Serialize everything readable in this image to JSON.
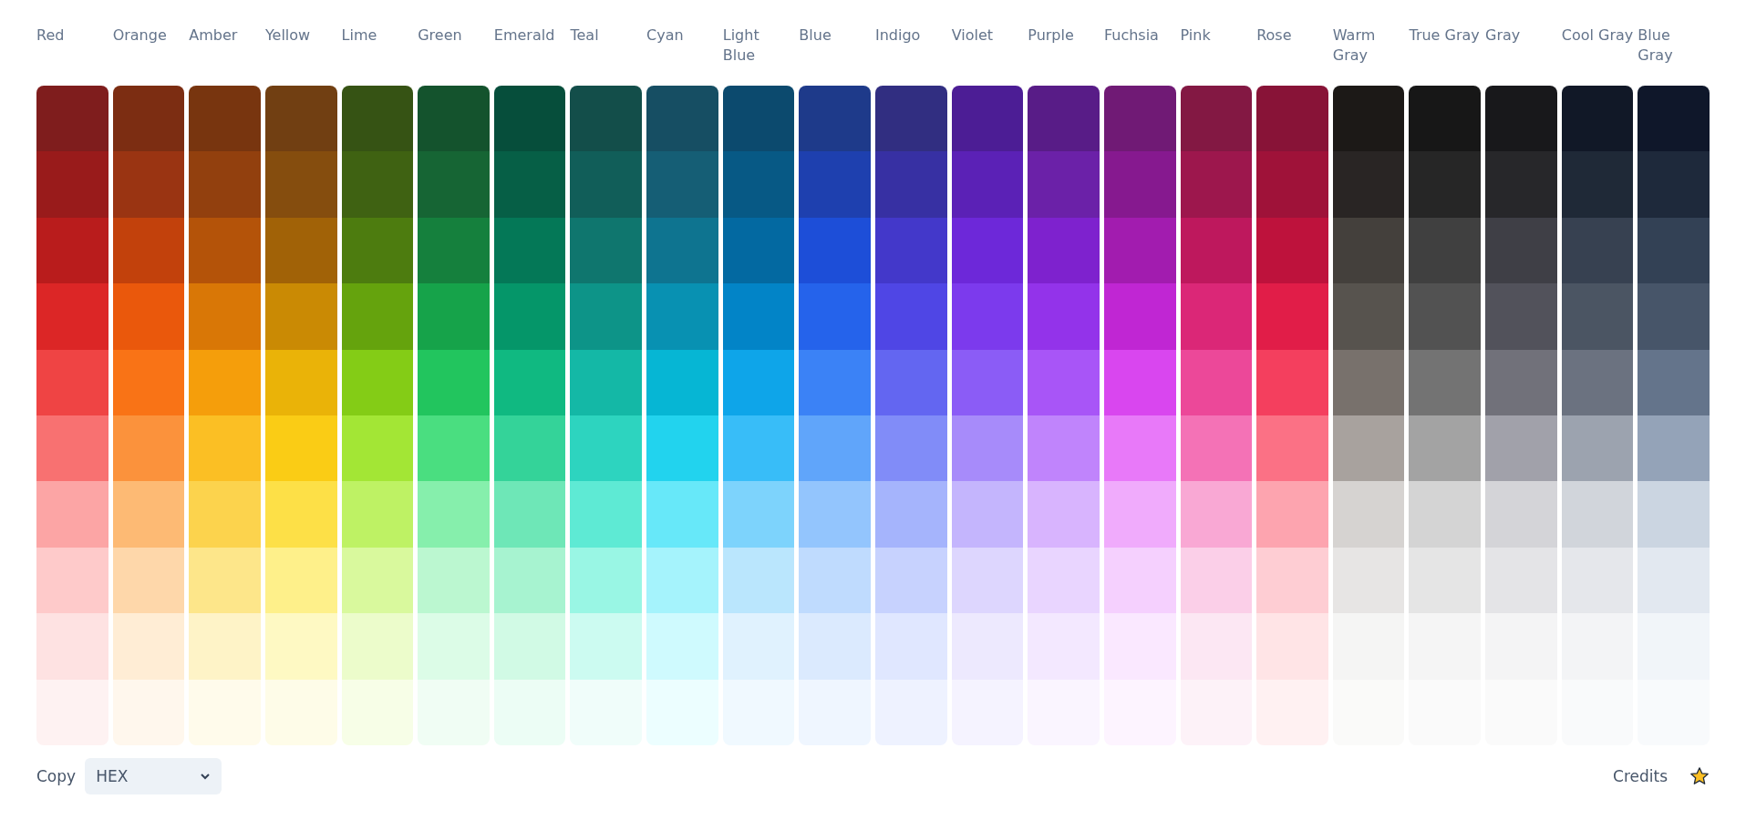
{
  "palettes": [
    {
      "name": "Red",
      "shades": [
        {
          "color": "#7f1d1d"
        },
        {
          "color": "#991b1b"
        },
        {
          "color": "#b91c1c"
        },
        {
          "color": "#dc2626"
        },
        {
          "color": "#ef4444"
        },
        {
          "color": "#f87171"
        },
        {
          "color": "#fca5a5"
        },
        {
          "color": "#fecaca"
        },
        {
          "color": "#fee2e2"
        },
        {
          "color": "#fef2f2"
        }
      ]
    },
    {
      "name": "Orange",
      "shades": [
        {
          "color": "#7c2d12"
        },
        {
          "color": "#9a3412"
        },
        {
          "color": "#c2410c"
        },
        {
          "color": "#ea580c"
        },
        {
          "color": "#f97316"
        },
        {
          "color": "#fb923c"
        },
        {
          "color": "#fdba74"
        },
        {
          "color": "#fed7aa"
        },
        {
          "color": "#ffedd5"
        },
        {
          "color": "#fff7ed"
        }
      ]
    },
    {
      "name": "Amber",
      "shades": [
        {
          "color": "#78350f"
        },
        {
          "color": "#92400e"
        },
        {
          "color": "#b45309"
        },
        {
          "color": "#d97706"
        },
        {
          "color": "#f59e0b"
        },
        {
          "color": "#fbbf24"
        },
        {
          "color": "#fcd34d"
        },
        {
          "color": "#fde68a"
        },
        {
          "color": "#fef3c7"
        },
        {
          "color": "#fffbeb"
        }
      ]
    },
    {
      "name": "Yellow",
      "shades": [
        {
          "color": "#713f12"
        },
        {
          "color": "#854d0e"
        },
        {
          "color": "#a16207"
        },
        {
          "color": "#ca8a04"
        },
        {
          "color": "#eab308"
        },
        {
          "color": "#facc15"
        },
        {
          "color": "#fde047"
        },
        {
          "color": "#fef08a"
        },
        {
          "color": "#fef9c3"
        },
        {
          "color": "#fefce8"
        }
      ]
    },
    {
      "name": "Lime",
      "shades": [
        {
          "color": "#365314"
        },
        {
          "color": "#3f6212"
        },
        {
          "color": "#4d7c0f"
        },
        {
          "color": "#65a30d"
        },
        {
          "color": "#84cc16"
        },
        {
          "color": "#a3e635"
        },
        {
          "color": "#bef264"
        },
        {
          "color": "#d9f99d"
        },
        {
          "color": "#ecfccb"
        },
        {
          "color": "#f7fee7"
        }
      ]
    },
    {
      "name": "Green",
      "shades": [
        {
          "color": "#14532d"
        },
        {
          "color": "#166534"
        },
        {
          "color": "#15803d"
        },
        {
          "color": "#16a34a"
        },
        {
          "color": "#22c55e"
        },
        {
          "color": "#4ade80"
        },
        {
          "color": "#86efac"
        },
        {
          "color": "#bbf7d0"
        },
        {
          "color": "#dcfce7"
        },
        {
          "color": "#f0fdf4"
        }
      ]
    },
    {
      "name": "Emerald",
      "shades": [
        {
          "color": "#064e3b"
        },
        {
          "color": "#065f46"
        },
        {
          "color": "#047857"
        },
        {
          "color": "#059669"
        },
        {
          "color": "#10b981"
        },
        {
          "color": "#34d399"
        },
        {
          "color": "#6ee7b7"
        },
        {
          "color": "#a7f3d0"
        },
        {
          "color": "#d1fae5"
        },
        {
          "color": "#ecfdf5"
        }
      ]
    },
    {
      "name": "Teal",
      "shades": [
        {
          "color": "#134e4a"
        },
        {
          "color": "#115e59"
        },
        {
          "color": "#0f766e"
        },
        {
          "color": "#0d9488"
        },
        {
          "color": "#14b8a6"
        },
        {
          "color": "#2dd4bf"
        },
        {
          "color": "#5eead4"
        },
        {
          "color": "#99f6e4"
        },
        {
          "color": "#ccfbf1"
        },
        {
          "color": "#f0fdfa"
        }
      ]
    },
    {
      "name": "Cyan",
      "shades": [
        {
          "color": "#164e63"
        },
        {
          "color": "#155e75"
        },
        {
          "color": "#0e7490"
        },
        {
          "color": "#0891b2"
        },
        {
          "color": "#06b6d4"
        },
        {
          "color": "#22d3ee"
        },
        {
          "color": "#67e8f9"
        },
        {
          "color": "#a5f3fc"
        },
        {
          "color": "#cffafe"
        },
        {
          "color": "#ecfeff"
        }
      ]
    },
    {
      "name": "Light Blue",
      "shades": [
        {
          "color": "#0c4a6e"
        },
        {
          "color": "#075985"
        },
        {
          "color": "#0369a1"
        },
        {
          "color": "#0284c7"
        },
        {
          "color": "#0ea5e9"
        },
        {
          "color": "#38bdf8"
        },
        {
          "color": "#7dd3fc"
        },
        {
          "color": "#bae6fd"
        },
        {
          "color": "#e0f2fe"
        },
        {
          "color": "#f0f9ff"
        }
      ]
    },
    {
      "name": "Blue",
      "shades": [
        {
          "color": "#1e3a8a"
        },
        {
          "color": "#1e40af"
        },
        {
          "color": "#1d4ed8"
        },
        {
          "color": "#2563eb"
        },
        {
          "color": "#3b82f6"
        },
        {
          "color": "#60a5fa"
        },
        {
          "color": "#93c5fd"
        },
        {
          "color": "#bfdbfe"
        },
        {
          "color": "#dbeafe"
        },
        {
          "color": "#eff6ff"
        }
      ]
    },
    {
      "name": "Indigo",
      "shades": [
        {
          "color": "#312e81"
        },
        {
          "color": "#3730a3"
        },
        {
          "color": "#4338ca"
        },
        {
          "color": "#4f46e5"
        },
        {
          "color": "#6366f1"
        },
        {
          "color": "#818cf8"
        },
        {
          "color": "#a5b4fc"
        },
        {
          "color": "#c7d2fe"
        },
        {
          "color": "#e0e7ff"
        },
        {
          "color": "#eef2ff"
        }
      ]
    },
    {
      "name": "Violet",
      "shades": [
        {
          "color": "#4c1d95"
        },
        {
          "color": "#5b21b6"
        },
        {
          "color": "#6d28d9"
        },
        {
          "color": "#7c3aed"
        },
        {
          "color": "#8b5cf6"
        },
        {
          "color": "#a78bfa"
        },
        {
          "color": "#c4b5fd"
        },
        {
          "color": "#ddd6fe"
        },
        {
          "color": "#ede9fe"
        },
        {
          "color": "#f5f3ff"
        }
      ]
    },
    {
      "name": "Purple",
      "shades": [
        {
          "color": "#581c87"
        },
        {
          "color": "#6b21a8"
        },
        {
          "color": "#7e22ce"
        },
        {
          "color": "#9333ea"
        },
        {
          "color": "#a855f7"
        },
        {
          "color": "#c084fc"
        },
        {
          "color": "#d8b4fe"
        },
        {
          "color": "#e9d5ff"
        },
        {
          "color": "#f3e8ff"
        },
        {
          "color": "#faf5ff"
        }
      ]
    },
    {
      "name": "Fuchsia",
      "shades": [
        {
          "color": "#701a75"
        },
        {
          "color": "#86198f"
        },
        {
          "color": "#a21caf"
        },
        {
          "color": "#c026d3"
        },
        {
          "color": "#d946ef"
        },
        {
          "color": "#e879f9"
        },
        {
          "color": "#f0abfc"
        },
        {
          "color": "#f5d0fe"
        },
        {
          "color": "#fae8ff"
        },
        {
          "color": "#fdf4ff"
        }
      ]
    },
    {
      "name": "Pink",
      "shades": [
        {
          "color": "#831843"
        },
        {
          "color": "#9d174d"
        },
        {
          "color": "#be185d"
        },
        {
          "color": "#db2777"
        },
        {
          "color": "#ec4899"
        },
        {
          "color": "#f472b6"
        },
        {
          "color": "#f9a8d4"
        },
        {
          "color": "#fbcfe8"
        },
        {
          "color": "#fce7f3"
        },
        {
          "color": "#fdf2f8"
        }
      ]
    },
    {
      "name": "Rose",
      "shades": [
        {
          "color": "#881337"
        },
        {
          "color": "#9f1239"
        },
        {
          "color": "#be123c"
        },
        {
          "color": "#e11d48"
        },
        {
          "color": "#f43f5e"
        },
        {
          "color": "#fb7185"
        },
        {
          "color": "#fda4af"
        },
        {
          "color": "#fecdd3"
        },
        {
          "color": "#ffe4e6"
        },
        {
          "color": "#fff1f2"
        }
      ]
    },
    {
      "name": "Warm Gray",
      "shades": [
        {
          "color": "#1c1917"
        },
        {
          "color": "#292524"
        },
        {
          "color": "#44403c"
        },
        {
          "color": "#57534e"
        },
        {
          "color": "#78716c"
        },
        {
          "color": "#a8a29e"
        },
        {
          "color": "#d6d3d1"
        },
        {
          "color": "#e7e5e4"
        },
        {
          "color": "#f5f5f4"
        },
        {
          "color": "#fafaf9"
        }
      ]
    },
    {
      "name": "True Gray",
      "shades": [
        {
          "color": "#171717"
        },
        {
          "color": "#262626"
        },
        {
          "color": "#404040"
        },
        {
          "color": "#525252"
        },
        {
          "color": "#737373"
        },
        {
          "color": "#a3a3a3"
        },
        {
          "color": "#d4d4d4"
        },
        {
          "color": "#e5e5e5"
        },
        {
          "color": "#f5f5f5"
        },
        {
          "color": "#fafafa"
        }
      ]
    },
    {
      "name": "Gray",
      "shades": [
        {
          "color": "#18181b"
        },
        {
          "color": "#27272a"
        },
        {
          "color": "#3f3f46"
        },
        {
          "color": "#52525b"
        },
        {
          "color": "#71717a"
        },
        {
          "color": "#a1a1aa"
        },
        {
          "color": "#d4d4d8"
        },
        {
          "color": "#e4e4e7"
        },
        {
          "color": "#f4f4f5"
        },
        {
          "color": "#fafafa"
        }
      ]
    },
    {
      "name": "Cool Gray",
      "shades": [
        {
          "color": "#111827"
        },
        {
          "color": "#1f2937"
        },
        {
          "color": "#374151"
        },
        {
          "color": "#4b5563"
        },
        {
          "color": "#6b7280"
        },
        {
          "color": "#9ca3af"
        },
        {
          "color": "#d1d5db"
        },
        {
          "color": "#e5e7eb"
        },
        {
          "color": "#f3f4f6"
        },
        {
          "color": "#f9fafb"
        }
      ]
    },
    {
      "name": "Blue Gray",
      "shades": [
        {
          "color": "#0f172a"
        },
        {
          "color": "#1e293b"
        },
        {
          "color": "#334155"
        },
        {
          "color": "#475569"
        },
        {
          "color": "#64748b"
        },
        {
          "color": "#94a3b8"
        },
        {
          "color": "#cbd5e1"
        },
        {
          "color": "#e2e8f0"
        },
        {
          "color": "#f1f5f9"
        },
        {
          "color": "#f8fafc"
        }
      ]
    }
  ],
  "copy": {
    "label": "Copy",
    "value": "HEX"
  },
  "credits": {
    "label": "Credits"
  }
}
